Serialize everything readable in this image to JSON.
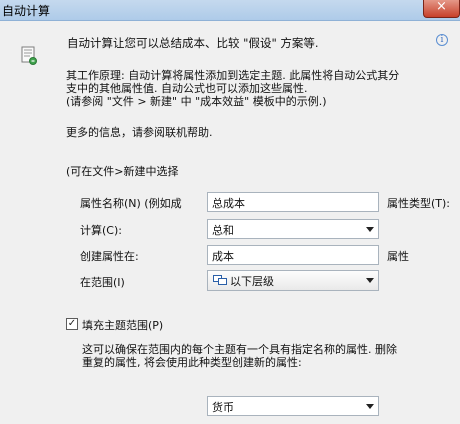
{
  "window": {
    "title": "自动计算",
    "close_symbol": "×"
  },
  "intro": {
    "heading": "自动计算让您可以总结成本、比较 \"假设\" 方案等.",
    "principle_line1": "其工作原理: 自动计算将属性添加到选定主题. 此属性将自动公式其分",
    "principle_line2": "支中的其他属性值. 自动公式也可以添加这些属性.",
    "principle_line3": "(请参阅 \"文件 > 新建\" 中 \"成本效益\" 模板中的示例.)",
    "more_info": "更多的信息，请参阅联机帮助."
  },
  "form": {
    "section_label": "(可在文件>新建中选择",
    "property_name_label": "属性名称(N) (例如成",
    "property_name_value": "总成本",
    "property_type_label": "属性类型(T):",
    "calculate_label": "计算(C):",
    "calculate_value": "总和",
    "create_property_label": "创建属性在:",
    "create_property_value": "成本",
    "property_suffix": "属性",
    "scope_label": "在范围(I)",
    "scope_value": "以下层级",
    "fill_scope_label": "填充主题范围(P)",
    "fill_scope_checked": true,
    "fill_desc_line1": "这可以确保在范围内的每个主题有一个具有指定名称的属性. 删除",
    "fill_desc_line2": "重复的属性, 将会使用此种类型创建新的属性:",
    "currency_value": "货币"
  }
}
